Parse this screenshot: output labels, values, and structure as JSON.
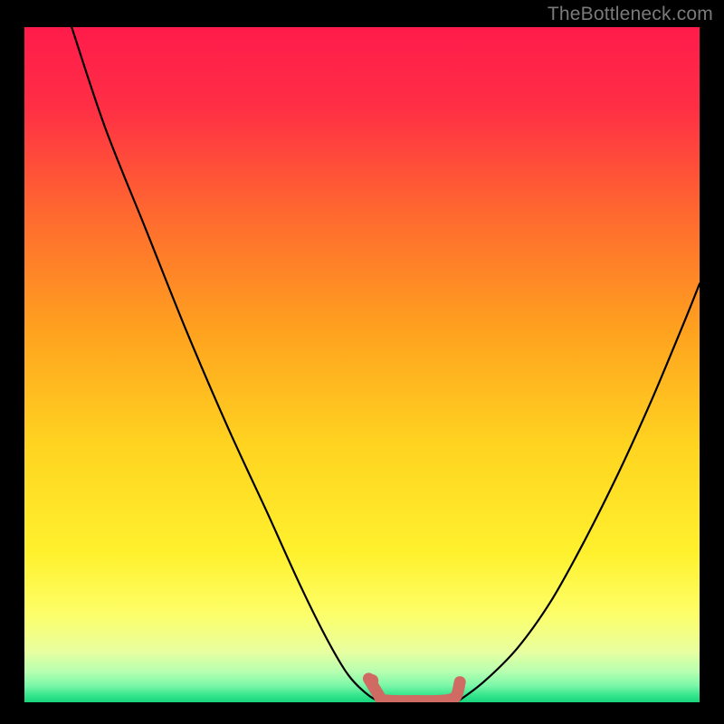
{
  "attribution": "TheBottleneck.com",
  "colors": {
    "black": "#000000",
    "attribution_text": "#7a7a7a",
    "curve_stroke": "#000000",
    "marker_fill": "#cf6b63",
    "gradient_stops": [
      {
        "offset": 0.0,
        "color": "#ff1b4b"
      },
      {
        "offset": 0.12,
        "color": "#ff2f45"
      },
      {
        "offset": 0.28,
        "color": "#ff6a2f"
      },
      {
        "offset": 0.45,
        "color": "#ffa21f"
      },
      {
        "offset": 0.62,
        "color": "#ffd420"
      },
      {
        "offset": 0.78,
        "color": "#fff12e"
      },
      {
        "offset": 0.87,
        "color": "#fdff6a"
      },
      {
        "offset": 0.925,
        "color": "#e8ffa0"
      },
      {
        "offset": 0.955,
        "color": "#b6ffb0"
      },
      {
        "offset": 0.975,
        "color": "#7cf7a8"
      },
      {
        "offset": 0.99,
        "color": "#34e58c"
      },
      {
        "offset": 1.0,
        "color": "#17d47c"
      }
    ]
  },
  "chart_data": {
    "type": "line",
    "title": "",
    "xlabel": "",
    "ylabel": "",
    "xlim": [
      0,
      100
    ],
    "ylim": [
      0,
      100
    ],
    "series": [
      {
        "name": "left-curve",
        "x": [
          7,
          12,
          18,
          24,
          30,
          36,
          41,
          45,
          48,
          51,
          53
        ],
        "values": [
          100,
          85,
          70,
          55,
          41,
          28,
          17,
          9,
          4,
          1,
          0
        ]
      },
      {
        "name": "right-curve",
        "x": [
          64,
          68,
          73,
          78,
          83,
          88,
          93,
          98,
          100
        ],
        "values": [
          0,
          3,
          8,
          15,
          24,
          34,
          45,
          57,
          62
        ]
      }
    ],
    "markers": {
      "name": "bottom-band",
      "type": "path",
      "x": [
        51,
        52.5,
        53,
        55,
        58,
        61,
        63,
        64,
        64.5
      ],
      "values": [
        3.5,
        1.0,
        0.4,
        0.2,
        0.2,
        0.2,
        0.4,
        1.0,
        3.0
      ],
      "dot": {
        "x": 51.5,
        "y": 3.2
      }
    }
  }
}
